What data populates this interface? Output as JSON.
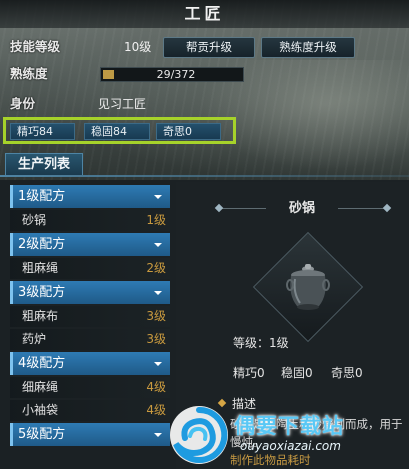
{
  "window": {
    "title": "工匠"
  },
  "skill": {
    "label": "技能等级",
    "level": "10级",
    "guild_upgrade_button": "帮贡升级",
    "proficiency_upgrade_button": "熟练度升级"
  },
  "proficiency": {
    "label": "熟练度",
    "value": "29/372",
    "progress": 0.078
  },
  "identity": {
    "label": "身份",
    "value": "见习工匠"
  },
  "attributes": [
    {
      "label": "精巧84"
    },
    {
      "label": "稳固84"
    },
    {
      "label": "奇思0"
    }
  ],
  "production": {
    "tab_label": "生产列表",
    "categories": [
      {
        "label": "1级配方",
        "items": [
          {
            "name": "砂锅",
            "level": "1级"
          }
        ]
      },
      {
        "label": "2级配方",
        "items": [
          {
            "name": "粗麻绳",
            "level": "2级"
          }
        ]
      },
      {
        "label": "3级配方",
        "items": [
          {
            "name": "粗麻布",
            "level": "3级"
          },
          {
            "name": "药炉",
            "level": "3级"
          }
        ]
      },
      {
        "label": "4级配方",
        "items": [
          {
            "name": "细麻绳",
            "level": "4级"
          },
          {
            "name": "小袖袋",
            "level": "4级"
          }
        ]
      },
      {
        "label": "5级配方",
        "items": []
      }
    ]
  },
  "detail": {
    "title": "砂锅",
    "level": "等级：1级",
    "stat_jingqiao": "精巧0",
    "stat_wengu": "稳固0",
    "stat_qisi": "奇思0",
    "desc_header": "描述",
    "desc_text": "砂锅是用陶土和砂烧制而成，用于慢炖。",
    "desc_link": "制作此物品耗时"
  },
  "watermark": {
    "name": "偶要下载站",
    "url": "ouyaoxiazai.com",
    "icon": "swirl-logo-icon"
  },
  "colors": {
    "highlight_box": "#a6d22a",
    "category_bg": "#2e7bb4",
    "level_text": "#c99a3f",
    "progress_fill": "#bd9a45"
  }
}
